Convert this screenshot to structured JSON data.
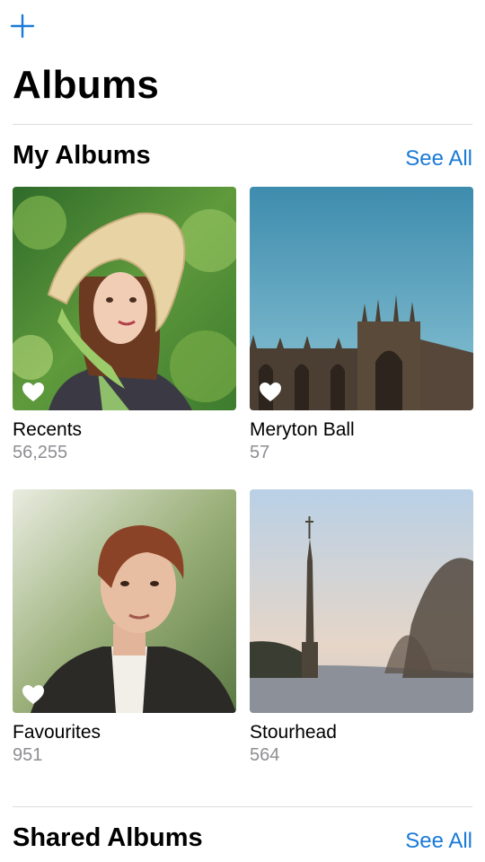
{
  "header": {
    "add_icon": "plus-icon",
    "title": "Albums"
  },
  "my_albums": {
    "title": "My Albums",
    "see_all": "See All",
    "items": [
      {
        "name": "Recents",
        "count": "56,255",
        "favourite_icon": "heart-icon"
      },
      {
        "name": "Meryton Ball",
        "count": "57",
        "favourite_icon": "heart-icon"
      },
      {
        "name": "Favourites",
        "count": "951",
        "favourite_icon": "heart-icon"
      },
      {
        "name": "Stourhead",
        "count": "564",
        "favourite_icon": null
      }
    ]
  },
  "shared_albums": {
    "title": "Shared Albums",
    "see_all": "See All"
  },
  "colors": {
    "accent": "#1a7ad8",
    "secondary_text": "#8e8e93",
    "divider": "#dcdcdc"
  }
}
